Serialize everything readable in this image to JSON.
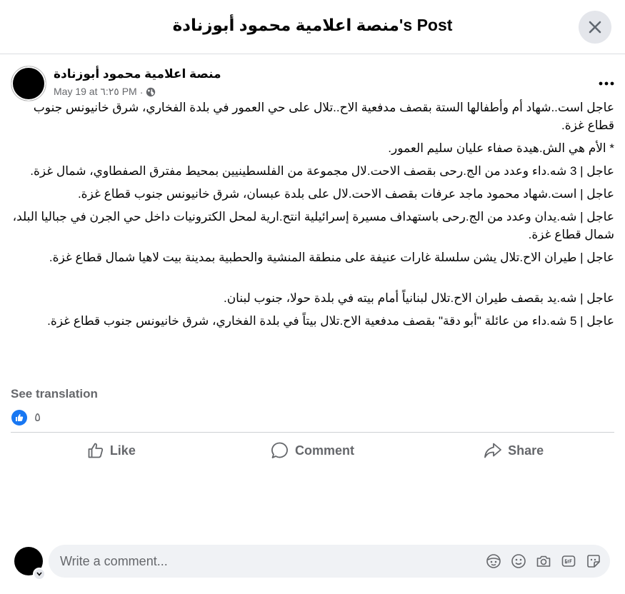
{
  "header": {
    "title": "منصة اعلامية محمود أبوزنادة's Post"
  },
  "post": {
    "author": "منصة اعلامية محمود أبوزنادة",
    "date": "May 19 at ٦:٢٥ PM",
    "separator": "·",
    "paragraphs": [
      "عاجل  است..شهاد أم وأطفالها الستة بقصف مدفعية الاح..تلال على حي العمور في بلدة الفخاري، شرق خانيونس جنوب قطاع غزة.",
      "* الأم هي الش.هيدة صفاء عليان سليم العمور.",
      "عاجل | 3 شه.داء وعدد من الج.رحى بقصف الاحت.لال مجموعة من الفلسطينيين بمحيط مفترق الصفطاوي، شمال غزة.",
      "عاجل | است.شهاد محمود ماجد عرفات بقصف الاحت.لال على بلدة عبسان، شرق خانيونس جنوب قطاع غزة.",
      "عاجل | شه.يدان وعدد من الج.رحى باستهداف مسيرة إسرائيلية انتح.ارية لمحل الكترونيات داخل حي الجرن في جباليا البلد، شمال قطاع غزة.",
      "عاجل | طيران الاح.تلال يشن سلسلة غارات عنيفة على منطقة المنشية والحطبية بمدينة بيت لاهيا شمال قطاع غزة.",
      "عاجل | شه.يد بقصف طيران الاح.تلال لبنانياً أمام بيته في بلدة حولا، جنوب لبنان.",
      "عاجل | 5 شه.داء من عائلة \"أبو دقة\" بقصف مدفعية الاح.تلال بيتاً في بلدة الفخاري، شرق خانيونس جنوب قطاع غزة."
    ],
    "see_translation": "See translation",
    "reaction_count": "٥"
  },
  "actions": {
    "like": "Like",
    "comment": "Comment",
    "share": "Share"
  },
  "comment": {
    "placeholder": "Write a comment..."
  },
  "colors": {
    "accent": "#1877f2",
    "muted": "#65676b",
    "divider": "#ced0d4"
  }
}
